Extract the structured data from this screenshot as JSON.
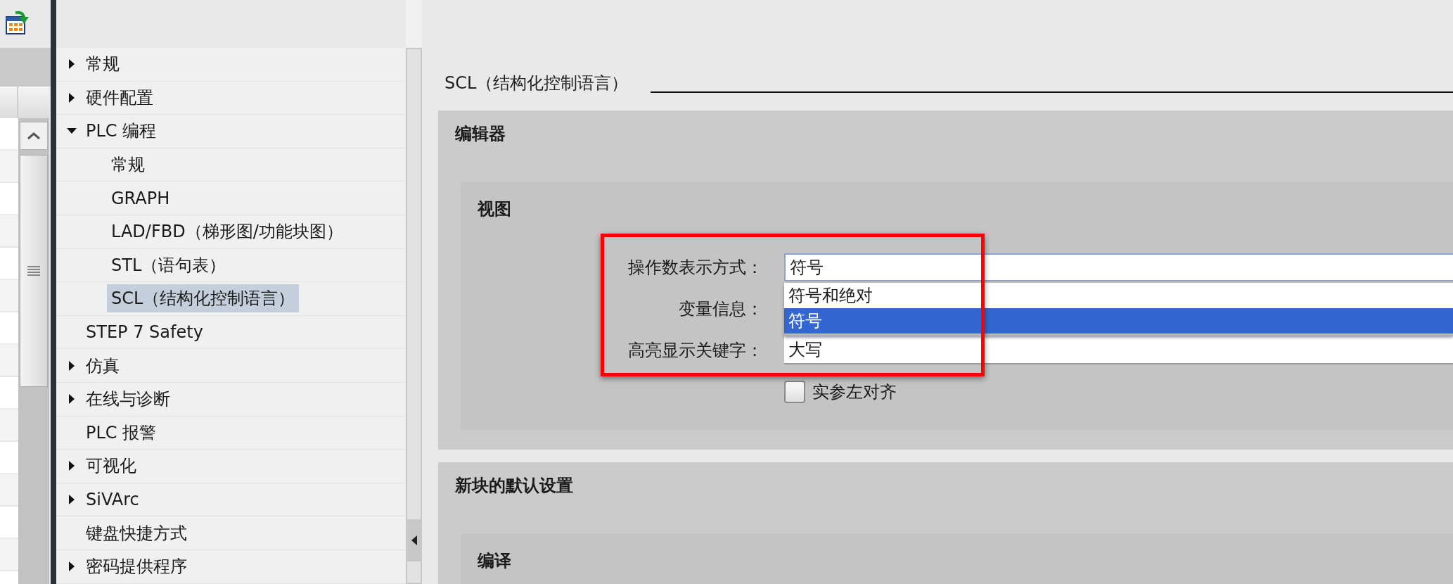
{
  "tree": {
    "items": [
      {
        "label": "常规",
        "kind": "group",
        "expanded": false,
        "selected": false
      },
      {
        "label": "硬件配置",
        "kind": "group",
        "expanded": false,
        "selected": false
      },
      {
        "label": "PLC 编程",
        "kind": "group",
        "expanded": true,
        "selected": false,
        "children": [
          {
            "label": "常规",
            "kind": "leaf",
            "selected": false
          },
          {
            "label": "GRAPH",
            "kind": "leaf",
            "selected": false
          },
          {
            "label": "LAD/FBD（梯形图/功能块图）",
            "kind": "leaf",
            "selected": false
          },
          {
            "label": "STL（语句表）",
            "kind": "leaf",
            "selected": false
          },
          {
            "label": "SCL（结构化控制语言）",
            "kind": "leaf",
            "selected": true
          }
        ]
      },
      {
        "label": "STEP 7 Safety",
        "kind": "leaf",
        "selected": false
      },
      {
        "label": "仿真",
        "kind": "group",
        "expanded": false,
        "selected": false
      },
      {
        "label": "在线与诊断",
        "kind": "group",
        "expanded": false,
        "selected": false
      },
      {
        "label": "PLC 报警",
        "kind": "leaf",
        "selected": false
      },
      {
        "label": "可视化",
        "kind": "group",
        "expanded": false,
        "selected": false
      },
      {
        "label": "SiVArc",
        "kind": "group",
        "expanded": false,
        "selected": false
      },
      {
        "label": "键盘快捷方式",
        "kind": "leaf",
        "selected": false
      },
      {
        "label": "密码提供程序",
        "kind": "group",
        "expanded": false,
        "selected": false
      }
    ]
  },
  "settings": {
    "title": "SCL（结构化控制语言）",
    "sections": [
      {
        "heading": "编辑器",
        "groups": [
          {
            "heading": "视图",
            "rows": [
              {
                "kind": "combo",
                "label": "操作数表示方式：",
                "value": "符号",
                "expanded": true,
                "options": [
                  {
                    "label": "符号和绝对",
                    "selected": false
                  },
                  {
                    "label": "符号",
                    "selected": true
                  }
                ]
              },
              {
                "kind": "combo",
                "label": "变量信息："
              },
              {
                "kind": "combo",
                "label": "高亮显示关键字：",
                "value": "大写",
                "expanded": false
              },
              {
                "kind": "checkbox",
                "label": "实参左对齐",
                "checked": false
              }
            ]
          }
        ]
      },
      {
        "heading": "新块的默认设置",
        "groups": [
          {
            "heading": "编译"
          }
        ]
      }
    ]
  }
}
